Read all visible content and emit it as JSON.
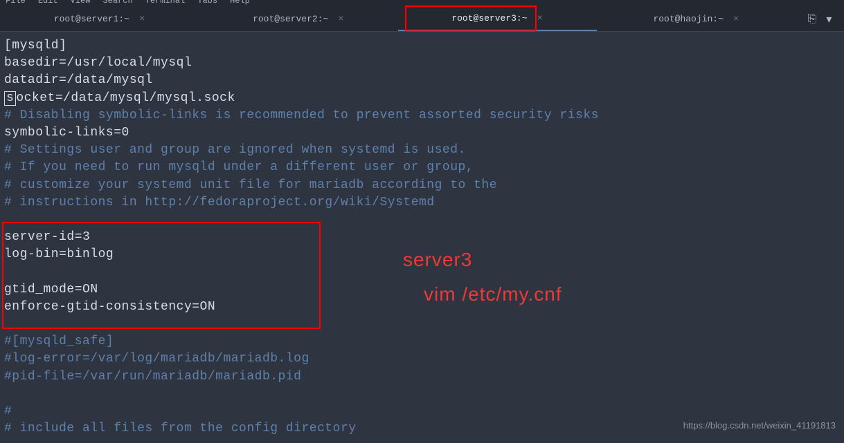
{
  "menu": {
    "file": "File",
    "edit": "Edit",
    "view": "View",
    "search": "Search",
    "terminal": "Terminal",
    "tabs": "Tabs",
    "help": "Help"
  },
  "tabs": [
    {
      "label": "root@server1:~",
      "active": false
    },
    {
      "label": "root@server2:~",
      "active": false
    },
    {
      "label": "root@server3:~",
      "active": true
    },
    {
      "label": "root@haojin:~",
      "active": false
    }
  ],
  "annotations": {
    "tab_highlight_index": 2,
    "overlay1": "server3",
    "overlay2": "vim /etc/my.cnf"
  },
  "terminal_lines": [
    {
      "type": "plain",
      "text": "[mysqld]"
    },
    {
      "type": "plain",
      "text": "basedir=/usr/local/mysql"
    },
    {
      "type": "plain",
      "text": "datadir=/data/mysql"
    },
    {
      "type": "socket",
      "prefix": "s",
      "rest": "ocket=/data/mysql/mysql.sock"
    },
    {
      "type": "comment",
      "text": "# Disabling symbolic-links is recommended to prevent assorted security risks"
    },
    {
      "type": "plain",
      "text": "symbolic-links=0"
    },
    {
      "type": "comment",
      "text": "# Settings user and group are ignored when systemd is used."
    },
    {
      "type": "comment",
      "text": "# If you need to run mysqld under a different user or group,"
    },
    {
      "type": "comment",
      "text": "# customize your systemd unit file for mariadb according to the"
    },
    {
      "type": "comment",
      "text": "# instructions in http://fedoraproject.org/wiki/Systemd"
    },
    {
      "type": "plain",
      "text": " "
    },
    {
      "type": "plain",
      "text": "server-id=3"
    },
    {
      "type": "plain",
      "text": "log-bin=binlog"
    },
    {
      "type": "plain",
      "text": " "
    },
    {
      "type": "plain",
      "text": "gtid_mode=ON"
    },
    {
      "type": "plain",
      "text": "enforce-gtid-consistency=ON"
    },
    {
      "type": "plain",
      "text": " "
    },
    {
      "type": "comment",
      "text": "#[mysqld_safe]"
    },
    {
      "type": "comment",
      "text": "#log-error=/var/log/mariadb/mariadb.log"
    },
    {
      "type": "comment",
      "text": "#pid-file=/var/run/mariadb/mariadb.pid"
    },
    {
      "type": "plain",
      "text": " "
    },
    {
      "type": "comment",
      "text": "#"
    },
    {
      "type": "comment",
      "text": "# include all files from the config directory"
    }
  ],
  "watermark": "https://blog.csdn.net/weixin_41191813"
}
